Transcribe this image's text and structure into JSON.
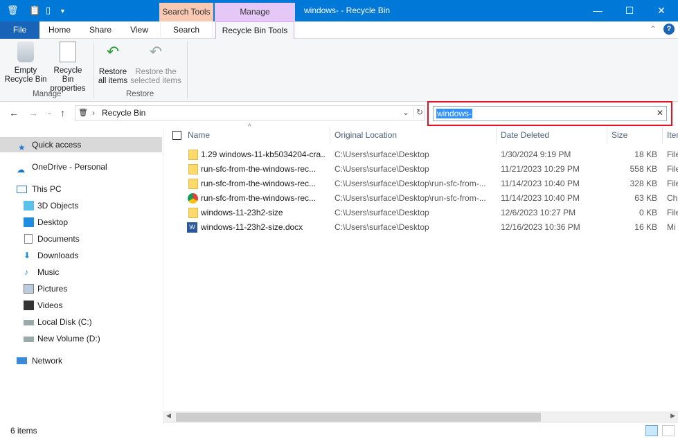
{
  "window": {
    "title": "windows- - Recycle Bin",
    "context_tabs": {
      "search_tools": "Search Tools",
      "manage": "Manage"
    },
    "controls": {
      "minimize": "—",
      "maximize": "☐",
      "close": "✕"
    }
  },
  "ribbon_tabs": [
    "File",
    "Home",
    "Share",
    "View",
    "Search",
    "Recycle Bin Tools"
  ],
  "ribbon": {
    "buttons": [
      {
        "label1": "Empty",
        "label2": "Recycle Bin"
      },
      {
        "label1": "Recycle Bin",
        "label2": "properties"
      },
      {
        "label1": "Restore",
        "label2": "all items"
      },
      {
        "label1": "Restore the",
        "label2": "selected items"
      }
    ],
    "groups": [
      "Manage",
      "Restore"
    ]
  },
  "address": {
    "path": "Recycle Bin"
  },
  "search": {
    "value": "windows-"
  },
  "nav": [
    "Quick access",
    "OneDrive - Personal",
    "This PC",
    "3D Objects",
    "Desktop",
    "Documents",
    "Downloads",
    "Music",
    "Pictures",
    "Videos",
    "Local Disk (C:)",
    "New Volume (D:)",
    "Network"
  ],
  "columns": [
    "Name",
    "Original Location",
    "Date Deleted",
    "Size",
    "Item"
  ],
  "files": [
    {
      "name": "1.29 windows-11-kb5034204-cra...",
      "loc": "C:\\Users\\surface\\Desktop",
      "date": "1/30/2024 9:19 PM",
      "size": "18 KB",
      "type": "File",
      "icon": "folder"
    },
    {
      "name": "run-sfc-from-the-windows-rec...",
      "loc": "C:\\Users\\surface\\Desktop",
      "date": "11/21/2023 10:29 PM",
      "size": "558 KB",
      "type": "File",
      "icon": "folder"
    },
    {
      "name": "run-sfc-from-the-windows-rec...",
      "loc": "C:\\Users\\surface\\Desktop\\run-sfc-from-...",
      "date": "11/14/2023 10:40 PM",
      "size": "328 KB",
      "type": "File",
      "icon": "folder"
    },
    {
      "name": "run-sfc-from-the-windows-rec...",
      "loc": "C:\\Users\\surface\\Desktop\\run-sfc-from-...",
      "date": "11/14/2023 10:40 PM",
      "size": "63 KB",
      "type": "Ch",
      "icon": "chrome"
    },
    {
      "name": "windows-11-23h2-size",
      "loc": "C:\\Users\\surface\\Desktop",
      "date": "12/6/2023 10:27 PM",
      "size": "0 KB",
      "type": "File",
      "icon": "folder"
    },
    {
      "name": "windows-11-23h2-size.docx",
      "loc": "C:\\Users\\surface\\Desktop",
      "date": "12/16/2023 10:36 PM",
      "size": "16 KB",
      "type": "Mi",
      "icon": "word"
    }
  ],
  "status": {
    "count": "6 items"
  },
  "colors": {
    "titlebar": "#0078d7",
    "highlight": "#e81123",
    "search_tools": "#f9c9b3",
    "manage": "#e5c8f8"
  }
}
